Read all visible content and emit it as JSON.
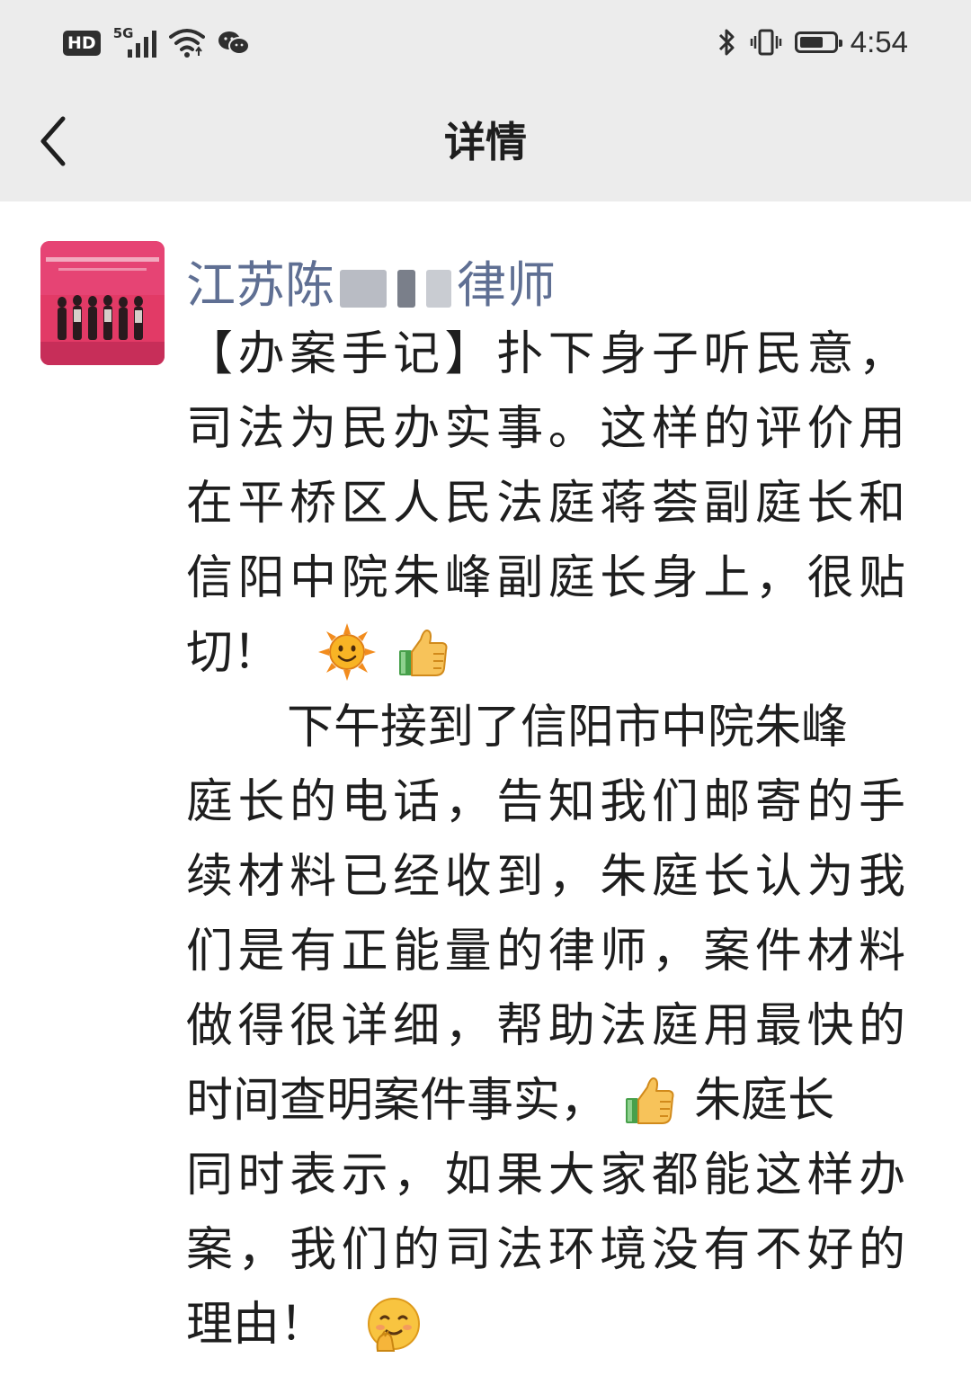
{
  "status_bar": {
    "hd_label": "HD",
    "network_label": "5G",
    "signal_bars": 4,
    "battery_percent": 70,
    "time": "4:54"
  },
  "nav": {
    "title": "详情",
    "back_icon": "chevron-left-icon"
  },
  "post": {
    "author_prefix": "江苏陈",
    "author_suffix": "律师",
    "lines": [
      "【办案手记】扑下身子听民意，",
      "司法为民办实事。这样的评价用",
      "在平桥区人民法庭蒋荟副庭长和",
      "信阳中院朱峰副庭长身上，很贴",
      "切！",
      "下午接到了信阳市中院朱峰",
      "庭长的电话，告知我们邮寄的手",
      "续材料已经收到，朱庭长认为我",
      "们是有正能量的律师，案件材料",
      "做得很详细，帮助法庭用最快的",
      "时间查明案件事实，",
      "朱庭长",
      "同时表示，如果大家都能这样办",
      "案，我们的司法环境没有不好的",
      "理由！"
    ],
    "emojis": [
      "sun-emoji",
      "thumbs-up-emoji",
      "thumbs-up-emoji",
      "shy-emoji"
    ]
  },
  "colors": {
    "topbar_bg": "#ececec",
    "nickname": "#5f6f93",
    "text": "#1e1e1e",
    "icon": "#2f2f2f"
  }
}
